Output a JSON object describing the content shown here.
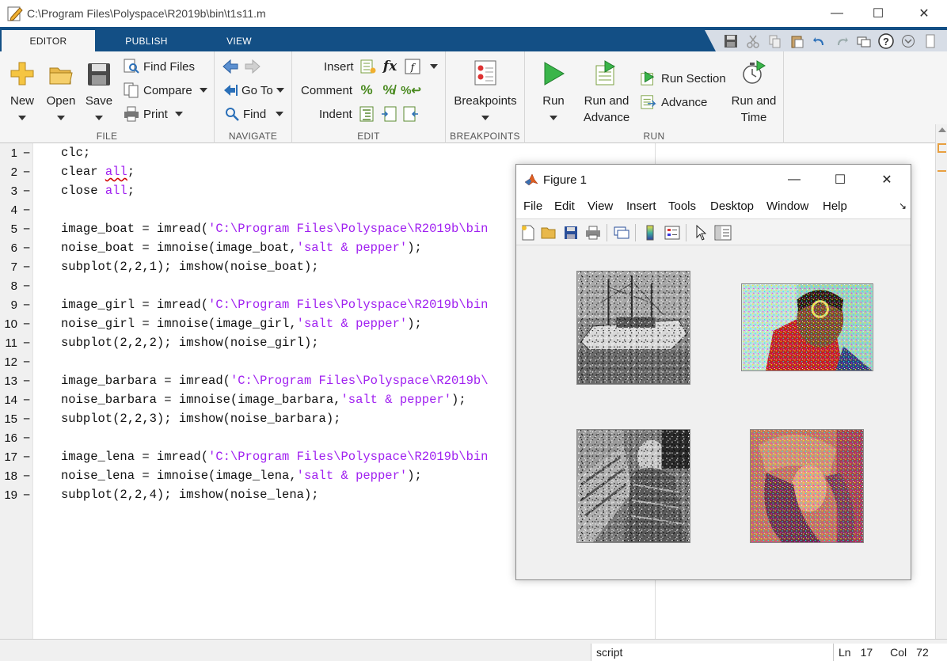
{
  "window": {
    "title": "C:\\Program Files\\Polyspace\\R2019b\\bin\\t1s11.m",
    "minimize": "—",
    "maximize": "☐",
    "close": "✕"
  },
  "tabs": [
    {
      "label": "EDITOR",
      "active": true
    },
    {
      "label": "PUBLISH",
      "active": false
    },
    {
      "label": "VIEW",
      "active": false
    }
  ],
  "ribbon": {
    "file": {
      "section_label": "FILE",
      "new": "New",
      "open": "Open",
      "save": "Save",
      "find_files": "Find Files",
      "compare": "Compare",
      "print": "Print"
    },
    "navigate": {
      "section_label": "NAVIGATE",
      "go_to": "Go To",
      "find": "Find"
    },
    "edit": {
      "section_label": "EDIT",
      "insert": "Insert",
      "comment": "Comment",
      "indent": "Indent",
      "fx": "fx"
    },
    "breakpoints": {
      "section_label": "BREAKPOINTS",
      "breakpoints": "Breakpoints"
    },
    "run": {
      "section_label": "RUN",
      "run": "Run",
      "run_and_advance_1": "Run and",
      "run_and_advance_2": "Advance",
      "run_section": "Run Section",
      "advance": "Advance",
      "run_and_time_1": "Run and",
      "run_and_time_2": "Time"
    }
  },
  "editor": {
    "lines": [
      {
        "n": "1",
        "parts": [
          [
            "t",
            "clc;"
          ]
        ]
      },
      {
        "n": "2",
        "parts": [
          [
            "t",
            "clear "
          ],
          [
            "w",
            "all"
          ],
          [
            "t",
            ";"
          ]
        ]
      },
      {
        "n": "3",
        "parts": [
          [
            "t",
            "close "
          ],
          [
            "k",
            "all"
          ],
          [
            "t",
            ";"
          ]
        ]
      },
      {
        "n": "4",
        "parts": []
      },
      {
        "n": "5",
        "parts": [
          [
            "t",
            "image_boat = imread("
          ],
          [
            "s",
            "'C:\\Program Files\\Polyspace\\R2019b\\bin"
          ]
        ]
      },
      {
        "n": "6",
        "parts": [
          [
            "t",
            "noise_boat = imnoise(image_boat,"
          ],
          [
            "s",
            "'salt & pepper'"
          ],
          [
            "t",
            ");"
          ]
        ]
      },
      {
        "n": "7",
        "parts": [
          [
            "t",
            "subplot(2,2,1); imshow(noise_boat);"
          ]
        ]
      },
      {
        "n": "8",
        "parts": []
      },
      {
        "n": "9",
        "parts": [
          [
            "t",
            "image_girl = imread("
          ],
          [
            "s",
            "'C:\\Program Files\\Polyspace\\R2019b\\bin"
          ]
        ]
      },
      {
        "n": "10",
        "parts": [
          [
            "t",
            "noise_girl = imnoise(image_girl,"
          ],
          [
            "s",
            "'salt & pepper'"
          ],
          [
            "t",
            ");"
          ]
        ]
      },
      {
        "n": "11",
        "parts": [
          [
            "t",
            "subplot(2,2,2); imshow(noise_girl);"
          ]
        ]
      },
      {
        "n": "12",
        "parts": []
      },
      {
        "n": "13",
        "parts": [
          [
            "t",
            "image_barbara = imread("
          ],
          [
            "s",
            "'C:\\Program Files\\Polyspace\\R2019b\\"
          ]
        ]
      },
      {
        "n": "14",
        "parts": [
          [
            "t",
            "noise_barbara = imnoise(image_barbara,"
          ],
          [
            "s",
            "'salt & pepper'"
          ],
          [
            "t",
            ");"
          ]
        ]
      },
      {
        "n": "15",
        "parts": [
          [
            "t",
            "subplot(2,2,3); imshow(noise_barbara);"
          ]
        ]
      },
      {
        "n": "16",
        "parts": []
      },
      {
        "n": "17",
        "parts": [
          [
            "t",
            "image_lena = imread("
          ],
          [
            "s",
            "'C:\\Program Files\\Polyspace\\R2019b\\bin"
          ]
        ]
      },
      {
        "n": "18",
        "parts": [
          [
            "t",
            "noise_lena = imnoise(image_lena,"
          ],
          [
            "s",
            "'salt & pepper'"
          ],
          [
            "t",
            ");"
          ]
        ]
      },
      {
        "n": "19",
        "parts": [
          [
            "t",
            "subplot(2,2,4); imshow(noise_lena);"
          ]
        ]
      }
    ]
  },
  "figure": {
    "title": "Figure 1",
    "menus": [
      "File",
      "Edit",
      "View",
      "Insert",
      "Tools",
      "Desktop",
      "Window",
      "Help"
    ]
  },
  "status": {
    "mode": "script",
    "ln_label": "Ln",
    "ln_value": "17",
    "col_label": "Col",
    "col_value": "72"
  },
  "colors": {
    "tab_bar": "#134f85",
    "string": "#a020f0",
    "accent": "#e8a040"
  }
}
